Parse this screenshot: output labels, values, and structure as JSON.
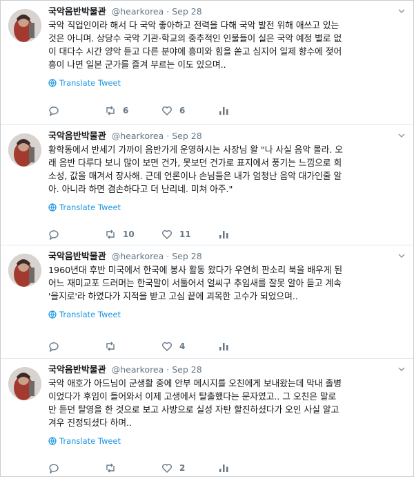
{
  "tweets": [
    {
      "name": "국악음반박물관",
      "handle": "@hearkorea",
      "date": "Sep 28",
      "text": "국악 직업인이라 해서 다 국악 좋아하고 전력을 다해 국악 발전 위해 애쓰고 있는\n것은 아니며. 상당수 국악 기관·학교의 중추적인 인물들이 실은 국악 예정 별로 없\n이 대다수 시간 양악 듣고 다른 분야에 흥미와 힘을 쏟고 심지어 일제 향수에 젖어\n흥이 나면 일본 군가를 즐겨 부르는 이도 있으며..",
      "translate": "Translate Tweet",
      "replies": "",
      "retweets": "6",
      "likes": "6"
    },
    {
      "name": "국악음반박물관",
      "handle": "@hearkorea",
      "date": "Sep 28",
      "text": "황학동에서 반세기 가까이 음반가게 운영하시는 사장님 왈 \"나 사실 음악 몰라. 오\n래 음반 다루다 보니 많이 보면 건가, 못보던 건가로 표지에서 풍기는 느낌으로 희\n소성, 값을 매겨서 장사해. 근데 언론이나 손님들은 내가 엄청난 음악 대가인줄 알\n아. 아니라 하면 겸손하다고 더 난리네. 미쳐 아주.\"",
      "translate": "Translate Tweet",
      "replies": "",
      "retweets": "10",
      "likes": "11"
    },
    {
      "name": "국악음반박물관",
      "handle": "@hearkorea",
      "date": "Sep 28",
      "text": "1960년대 후반 미국에서 한국에 봉사 활동 왔다가 우연히 판소리 북을 배우게 된\n어느 재미교포 드러머는 한국말이 서툴어서 얼씨구 추임새를 잘못 알아 듣고 계속\n'을지로'라 하였다가 지적을 받고 고심 끝에 괴목한 고수가 되었으며..",
      "translate": "Translate Tweet",
      "replies": "",
      "retweets": "",
      "likes": "4"
    },
    {
      "name": "국악음반박물관",
      "handle": "@hearkorea",
      "date": "Sep 28",
      "text": "국악 애호가 아드님이 군생활 중에 안부 메시지를 오친에게 보내왔는데 막내 졸병\n이었다가 후임이 들어와서 이제 고생에서 탈출했다는 문자였고.. 그 오친은 말로\n만 듣던 탈영을 한 것으로 보고 사방으로 실성 자탄 할진하셨다가 오인 사실 알고\n겨우 진정되셨다 하며..",
      "translate": "Translate Tweet",
      "replies": "",
      "retweets": "",
      "likes": "2"
    }
  ],
  "colors": {
    "link": "#1b95e0",
    "meta": "#657786",
    "border": "#e1e8ed"
  },
  "icons": {
    "reply": "reply-icon",
    "retweet": "retweet-icon",
    "like": "heart-icon",
    "stats": "bar-chart-icon",
    "translate": "globe-icon",
    "menu": "chevron-down-icon"
  }
}
